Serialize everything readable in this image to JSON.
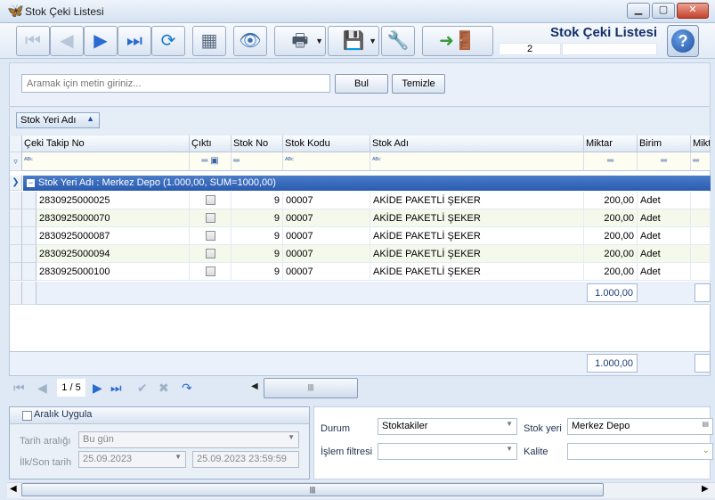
{
  "window": {
    "title": "Stok Çeki Listesi"
  },
  "toolbar": {
    "title": "Stok Çeki Listesi",
    "counter": "2"
  },
  "search": {
    "placeholder": "Aramak için metin giriniz...",
    "find_label": "Bul",
    "clear_label": "Temizle"
  },
  "group_panel": {
    "chip_label": "Stok Yeri Adı"
  },
  "grid": {
    "columns": [
      "Çeki Takip No",
      "Çıktı",
      "Stok No",
      "Stok Kodu",
      "Stok Adı",
      "Miktar",
      "Birim",
      "Mikt"
    ],
    "group_label": "Stok Yeri Adı : Merkez Depo (1.000,00, SUM=1000,00)",
    "rows": [
      {
        "takip_no": "2830925000025",
        "stok_no": "9",
        "stok_kodu": "00007",
        "stok_adi": "AKİDE PAKETLİ ŞEKER",
        "miktar": "200,00",
        "birim": "Adet"
      },
      {
        "takip_no": "2830925000070",
        "stok_no": "9",
        "stok_kodu": "00007",
        "stok_adi": "AKİDE PAKETLİ ŞEKER",
        "miktar": "200,00",
        "birim": "Adet"
      },
      {
        "takip_no": "2830925000087",
        "stok_no": "9",
        "stok_kodu": "00007",
        "stok_adi": "AKİDE PAKETLİ ŞEKER",
        "miktar": "200,00",
        "birim": "Adet"
      },
      {
        "takip_no": "2830925000094",
        "stok_no": "9",
        "stok_kodu": "00007",
        "stok_adi": "AKİDE PAKETLİ ŞEKER",
        "miktar": "200,00",
        "birim": "Adet"
      },
      {
        "takip_no": "2830925000100",
        "stok_no": "9",
        "stok_kodu": "00007",
        "stok_adi": "AKİDE PAKETLİ ŞEKER",
        "miktar": "200,00",
        "birim": "Adet"
      }
    ],
    "group_sum": "1.000,00",
    "total_sum": "1.000,00"
  },
  "navigator": {
    "page": "1 / 5"
  },
  "range": {
    "header": "Aralık Uygula",
    "date_range_label": "Tarih aralığı",
    "date_range_value": "Bu gün",
    "first_last_label": "İlk/Son tarih",
    "first_date": "25.09.2023",
    "last_date": "25.09.2023 23:59:59"
  },
  "filters": {
    "durum_label": "Durum",
    "durum_value": "Stoktakiler",
    "stok_yeri_label": "Stok yeri",
    "stok_yeri_value": "Merkez Depo",
    "islem_label": "İşlem filtresi",
    "islem_value": "",
    "kalite_label": "Kalite"
  },
  "colors": {
    "group_row": "#2a5bb0",
    "accent": "#2a6ad1",
    "title": "#15306a"
  }
}
